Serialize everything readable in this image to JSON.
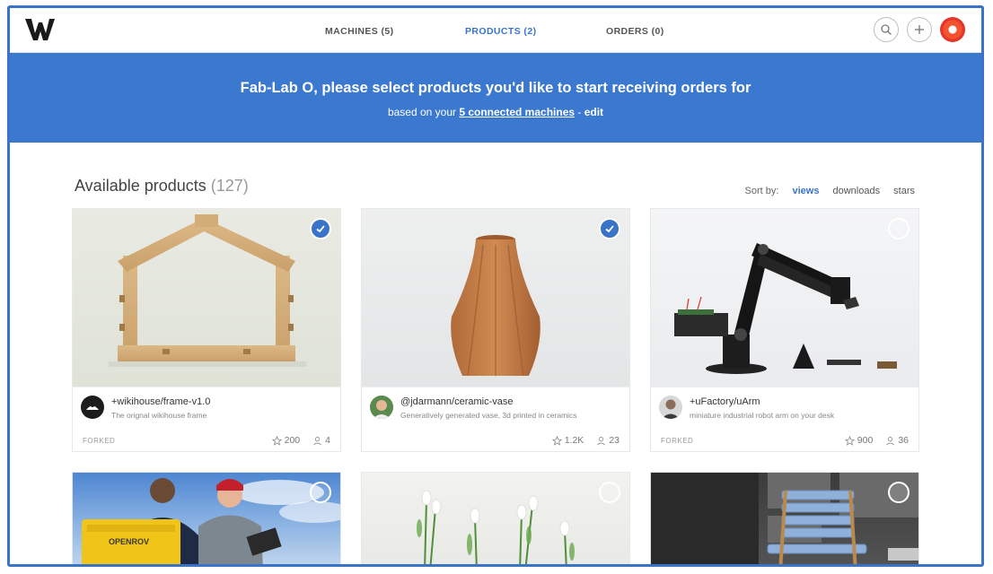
{
  "nav": {
    "machines": "MACHINES (5)",
    "products": "PRODUCTS (2)",
    "orders": "ORDERS (0)"
  },
  "banner": {
    "headline": "Fab-Lab O, please select products you'd like to start receiving orders for",
    "sub_prefix": "based on your ",
    "sub_link": "5 connected machines",
    "sub_sep": " - ",
    "sub_edit": "edit"
  },
  "section": {
    "title": "Available products",
    "count": "(127)"
  },
  "sort": {
    "label": "Sort by:",
    "options": [
      "views",
      "downloads",
      "stars"
    ],
    "active": "views"
  },
  "colors": {
    "accent": "#3b78cf",
    "active_nav": "#3a74c9"
  },
  "products": [
    {
      "name": "+wikihouse/frame-v1.0",
      "desc": "The orignal wikihouse frame",
      "tag": "FORKED",
      "stars": "200",
      "forks": "4",
      "selected": true
    },
    {
      "name": "@jdarmann/ceramic-vase",
      "desc": "Generatively generated vase, 3d printed in ceramics",
      "tag": "",
      "stars": "1.2K",
      "forks": "23",
      "selected": true
    },
    {
      "name": "+uFactory/uArm",
      "desc": "miniature industrial robot arm on your desk",
      "tag": "FORKED",
      "stars": "900",
      "forks": "36",
      "selected": false
    },
    {
      "case_label": "OPENROV",
      "selected": false
    },
    {
      "selected": false
    },
    {
      "selected": false
    }
  ]
}
